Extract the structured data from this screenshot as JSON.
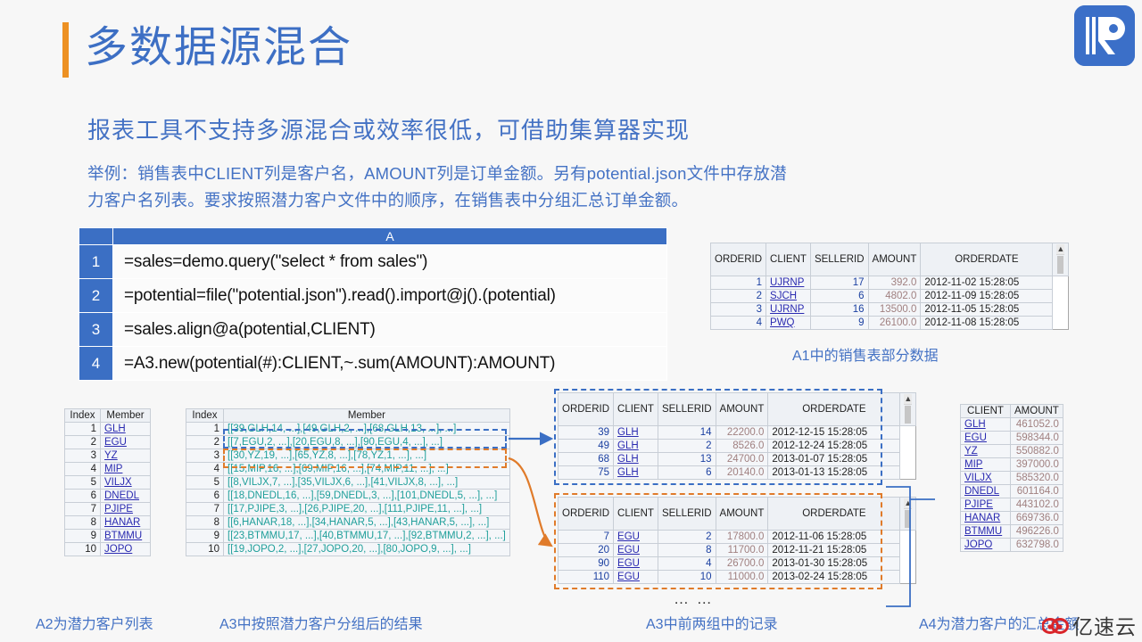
{
  "slide": {
    "title": "多数据源混合",
    "accent_orange": "#ed9122",
    "accent_blue": "#4472c4",
    "subtitle": "报表工具不支持多源混合或效率很低，可借助集算器实现",
    "description_line1": "举例：销售表中CLIENT列是客户名，AMOUNT列是订单金额。另有potential.json文件中存放潜",
    "description_line2": "力客户名列表。要求按照潜力客户文件中的顺序，在销售表中分组汇总订单金额。"
  },
  "logo": {
    "name": "raqsoft-r-logo",
    "color": "#3b6fc8"
  },
  "watermark": {
    "text": "亿速云",
    "icon": "cloud-icon",
    "color": "#d9252a"
  },
  "code_table": {
    "column_header": "A",
    "rows": [
      {
        "num": "1",
        "code": "=sales=demo.query(\"select * from sales\")"
      },
      {
        "num": "2",
        "code": "=potential=file(\"potential.json\").read().import@j().(potential)"
      },
      {
        "num": "3",
        "code": "=sales.align@a(potential,CLIENT)"
      },
      {
        "num": "4",
        "code": "=A3.new(potential(#):CLIENT,~.sum(AMOUNT):AMOUNT)"
      }
    ]
  },
  "sales_top": {
    "caption": "A1中的销售表部分数据",
    "headers": [
      "ORDERID",
      "CLIENT",
      "SELLERID",
      "AMOUNT",
      "ORDERDATE"
    ],
    "rows": [
      [
        "1",
        "UJRNP",
        "17",
        "392.0",
        "2012-11-02 15:28:05"
      ],
      [
        "2",
        "SJCH",
        "6",
        "4802.0",
        "2012-11-09 15:28:05"
      ],
      [
        "3",
        "UJRNP",
        "16",
        "13500.0",
        "2012-11-05 15:28:05"
      ],
      [
        "4",
        "PWQ",
        "9",
        "26100.0",
        "2012-11-08 15:28:05"
      ]
    ]
  },
  "a2_table": {
    "caption": "A2为潜力客户列表",
    "headers": [
      "Index",
      "Member"
    ],
    "rows": [
      [
        "1",
        "GLH"
      ],
      [
        "2",
        "EGU"
      ],
      [
        "3",
        "YZ"
      ],
      [
        "4",
        "MIP"
      ],
      [
        "5",
        "VILJX"
      ],
      [
        "6",
        "DNEDL"
      ],
      [
        "7",
        "PJIPE"
      ],
      [
        "8",
        "HANAR"
      ],
      [
        "9",
        "BTMMU"
      ],
      [
        "10",
        "JOPO"
      ]
    ]
  },
  "a3_table": {
    "caption": "A3中按照潜力客户分组后的结果",
    "headers": [
      "Index",
      "Member"
    ],
    "rows": [
      [
        "1",
        "[[39,GLH,14, ...],[49,GLH,2, ...],[68,GLH,13, ...], ...]"
      ],
      [
        "2",
        "[[7,EGU,2, ...],[20,EGU,8, ...],[90,EGU,4, ...], ...]"
      ],
      [
        "3",
        "[[30,YZ,19, ...],[65,YZ,8, ...],[78,YZ,1, ...], ...]"
      ],
      [
        "4",
        "[[15,MIP,16, ...],[69,MIP,16, ...],[74,MIP,11, ...], ...]"
      ],
      [
        "5",
        "[[8,VILJX,7, ...],[35,VILJX,6, ...],[41,VILJX,8, ...], ...]"
      ],
      [
        "6",
        "[[18,DNEDL,16, ...],[59,DNEDL,3, ...],[101,DNEDL,5, ...], ...]"
      ],
      [
        "7",
        "[[17,PJIPE,3, ...],[26,PJIPE,20, ...],[111,PJIPE,11, ...], ...]"
      ],
      [
        "8",
        "[[6,HANAR,18, ...],[34,HANAR,5, ...],[43,HANAR,5, ...], ...]"
      ],
      [
        "9",
        "[[23,BTMMU,17, ...],[40,BTMMU,17, ...],[92,BTMMU,2, ...], ...]"
      ],
      [
        "10",
        "[[19,JOPO,2, ...],[27,JOPO,20, ...],[80,JOPO,9, ...], ...]"
      ]
    ]
  },
  "detail_tables": {
    "caption": "A3中前两组中的记录",
    "ellipsis": "… …",
    "headers": [
      "ORDERID",
      "CLIENT",
      "SELLERID",
      "AMOUNT",
      "ORDERDATE"
    ],
    "group_glh": {
      "highlight_color": "#3b6fc4",
      "rows": [
        [
          "39",
          "GLH",
          "14",
          "22200.0",
          "2012-12-15 15:28:05"
        ],
        [
          "49",
          "GLH",
          "2",
          "8526.0",
          "2012-12-24 15:28:05"
        ],
        [
          "68",
          "GLH",
          "13",
          "24700.0",
          "2013-01-07 15:28:05"
        ],
        [
          "75",
          "GLH",
          "6",
          "20140.0",
          "2013-01-13 15:28:05"
        ]
      ]
    },
    "group_egu": {
      "highlight_color": "#e07b2a",
      "rows": [
        [
          "7",
          "EGU",
          "2",
          "17800.0",
          "2012-11-06 15:28:05"
        ],
        [
          "20",
          "EGU",
          "8",
          "11700.0",
          "2012-11-21 15:28:05"
        ],
        [
          "90",
          "EGU",
          "4",
          "26700.0",
          "2013-01-30 15:28:05"
        ],
        [
          "110",
          "EGU",
          "10",
          "11000.0",
          "2013-02-24 15:28:05"
        ]
      ]
    }
  },
  "a4_table": {
    "caption": "A4为潜力客户的汇总金额",
    "headers": [
      "CLIENT",
      "AMOUNT"
    ],
    "rows": [
      [
        "GLH",
        "461052.0"
      ],
      [
        "EGU",
        "598344.0"
      ],
      [
        "YZ",
        "550882.0"
      ],
      [
        "MIP",
        "397000.0"
      ],
      [
        "VILJX",
        "585320.0"
      ],
      [
        "DNEDL",
        "601164.0"
      ],
      [
        "PJIPE",
        "443102.0"
      ],
      [
        "HANAR",
        "669736.0"
      ],
      [
        "BTMMU",
        "496226.0"
      ],
      [
        "JOPO",
        "632798.0"
      ]
    ]
  }
}
